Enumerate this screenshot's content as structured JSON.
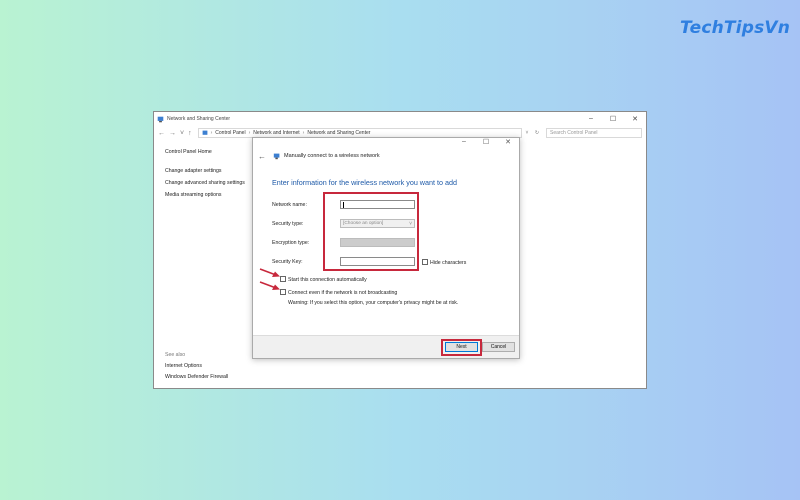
{
  "brand": {
    "text": "TechTipsVn",
    "color": "#2f7fe0"
  },
  "window": {
    "title": "Network and Sharing Center",
    "controls": {
      "minimize": "–",
      "maximize": "☐",
      "close": "✕"
    },
    "breadcrumbs": [
      "Control Panel",
      "Network and Internet",
      "Network and Sharing Center"
    ],
    "search_placeholder": "Search Control Panel"
  },
  "sidebar": {
    "home": "Control Panel Home",
    "items": [
      "Change adapter settings",
      "Change advanced sharing settings",
      "Media streaming options"
    ]
  },
  "see_also": {
    "header": "See also",
    "items": [
      "Internet Options",
      "Windows Defender Firewall"
    ]
  },
  "dialog": {
    "title": "Manually connect to a wireless network",
    "controls": {
      "minimize": "–",
      "maximize": "☐",
      "close": "✕"
    },
    "heading": "Enter information for the wireless network you want to add",
    "fields": {
      "network_name_label": "Network name:",
      "network_name_value": "",
      "security_type_label": "Security type:",
      "security_type_value": "[Choose an option]",
      "encryption_type_label": "Encryption type:",
      "security_key_label": "Security Key:",
      "security_key_value": "",
      "hide_characters": "Hide characters"
    },
    "checkboxes": {
      "start_auto": "Start this connection automatically",
      "connect_hidden": "Connect even if the network is not broadcasting"
    },
    "warning": "Warning: If you select this option, your computer's privacy might be at risk.",
    "buttons": {
      "next": "Next",
      "cancel": "Cancel"
    }
  },
  "colors": {
    "highlight": "#c7283c",
    "heading": "#1e5aa8",
    "accent": "#0078d7"
  }
}
